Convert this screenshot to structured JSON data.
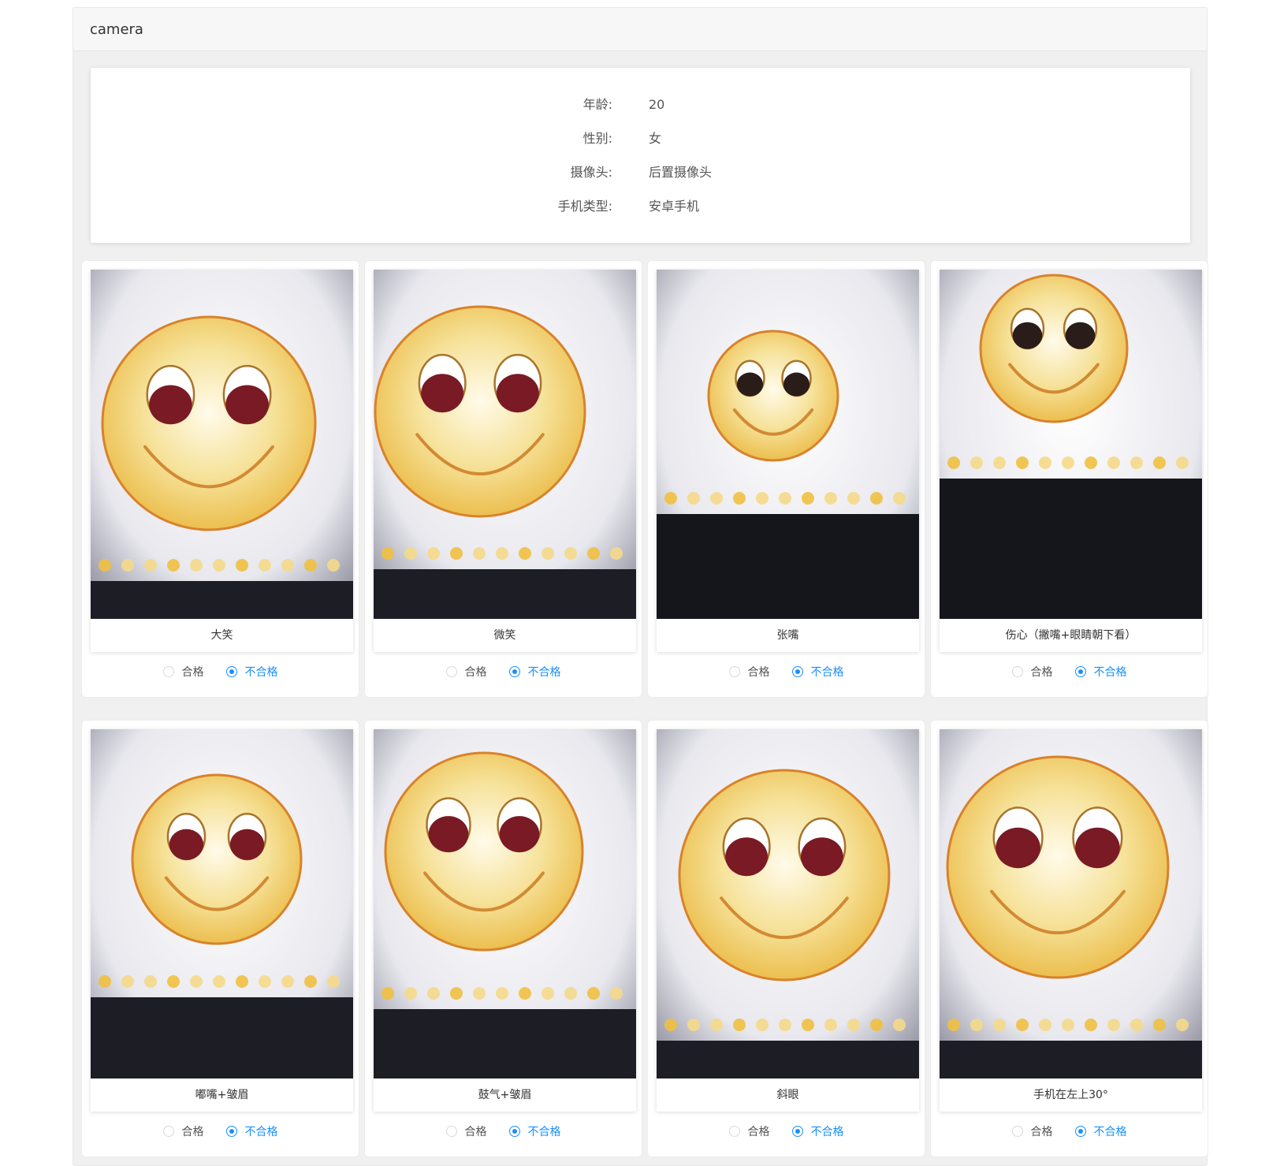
{
  "panel": {
    "title": "camera"
  },
  "info": [
    {
      "label": "年龄:",
      "value": "20"
    },
    {
      "label": "性别:",
      "value": "女"
    },
    {
      "label": "摄像头:",
      "value": "后置摄像头"
    },
    {
      "label": "手机类型:",
      "value": "安卓手机"
    }
  ],
  "radio_labels": {
    "pass": "合格",
    "fail": "不合格"
  },
  "colors": {
    "accent": "#1890ff",
    "face": "#f2cf6a",
    "face_edge": "#d9822b",
    "eye": "#7a1a24"
  },
  "items": [
    {
      "caption": "大笑",
      "selected": "fail",
      "photo_icon": "smiley-face-icon"
    },
    {
      "caption": "微笑",
      "selected": "fail",
      "photo_icon": "smiley-face-icon"
    },
    {
      "caption": "张嘴",
      "selected": "fail",
      "photo_icon": "smiley-face-icon"
    },
    {
      "caption": "伤心（撇嘴+眼睛朝下看）",
      "selected": "fail",
      "photo_icon": "smiley-face-icon"
    },
    {
      "caption": "嘟嘴+皱眉",
      "selected": "fail",
      "photo_icon": "smiley-face-icon"
    },
    {
      "caption": "鼓气+皱眉",
      "selected": "fail",
      "photo_icon": "smiley-face-icon"
    },
    {
      "caption": "斜眼",
      "selected": "fail",
      "photo_icon": "smiley-face-icon"
    },
    {
      "caption": "手机在左上30°",
      "selected": "fail",
      "photo_icon": "smiley-face-icon"
    }
  ]
}
